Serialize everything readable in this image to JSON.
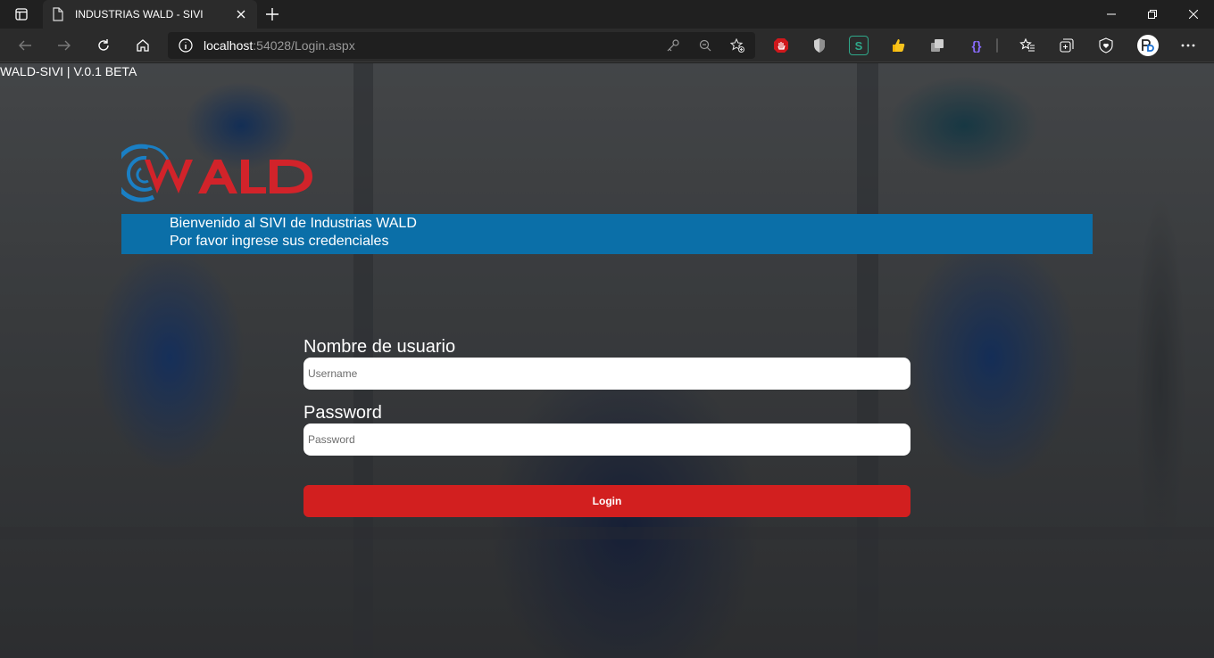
{
  "browser": {
    "tab_title": "INDUSTRIAS WALD - SIVI",
    "url_host": "localhost",
    "url_rest": ":54028/Login.aspx"
  },
  "extensions": [
    "S",
    "{}"
  ],
  "page": {
    "version_text": "WALD-SIVI | V.0.1 BETA",
    "logo_text": "WALD",
    "banner": {
      "line1": "Bienvenido al SIVI de Industrias WALD",
      "line2": "Por favor ingrese sus credenciales"
    },
    "form": {
      "username_label": "Nombre de usuario",
      "username_placeholder": "Username",
      "password_label": "Password",
      "password_placeholder": "Password",
      "login_label": "Login"
    }
  },
  "colors": {
    "banner_bg": "#0b6fa8",
    "login_button": "#d21f1f",
    "logo_red": "#d2232a",
    "logo_blue": "#1a7fc4"
  }
}
